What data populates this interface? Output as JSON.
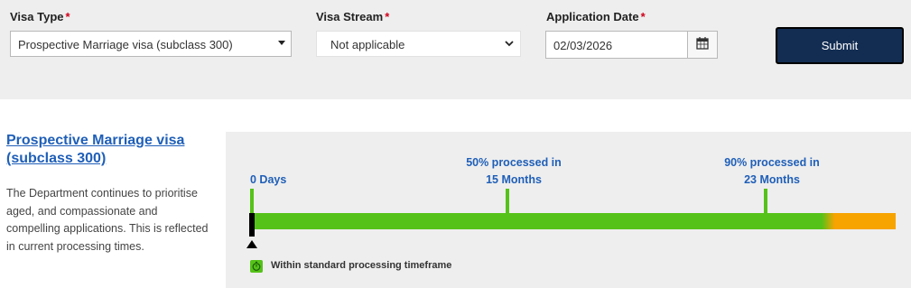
{
  "form": {
    "visa_type": {
      "label": "Visa Type",
      "required_mark": "*",
      "value": "Prospective Marriage visa (subclass 300)"
    },
    "visa_stream": {
      "label": "Visa Stream",
      "required_mark": "*",
      "value": "Not applicable"
    },
    "application_date": {
      "label": "Application Date",
      "required_mark": "*",
      "value": "02/03/2026"
    },
    "submit_label": "Submit"
  },
  "result": {
    "title": "Prospective Marriage visa (subclass 300)",
    "description": "The Department continues to prioritise aged, and compassionate and compelling applications. This is reflected in current processing times.",
    "milestones": [
      {
        "line1": "0 Days",
        "line2": ""
      },
      {
        "line1": "50% processed in",
        "line2": "15 Months"
      },
      {
        "line1": "90% processed in",
        "line2": "23 Months"
      }
    ],
    "legend": "Within standard processing timeframe"
  },
  "colors": {
    "accent": "#1f5fb8",
    "button": "#132d52",
    "green": "#55c219",
    "orange": "#f7a300",
    "required": "#d0021b"
  },
  "icons": {
    "select_caret": "caret-down-icon",
    "stream_chevron": "chevron-down-icon",
    "calendar": "calendar-icon",
    "legend": "timer-icon",
    "marker": "triangle-up-icon"
  }
}
